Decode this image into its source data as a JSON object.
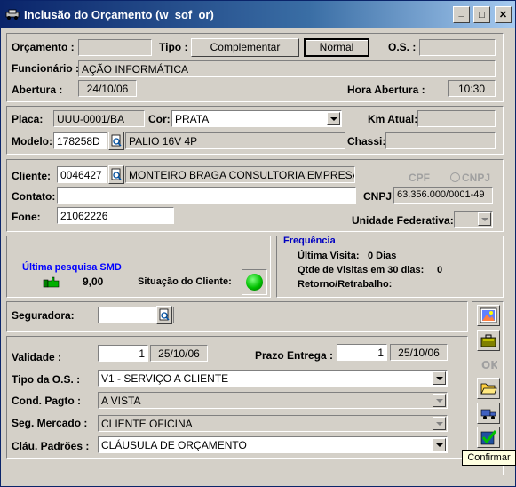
{
  "window": {
    "title": "Inclusão do Orçamento (w_sof_or)"
  },
  "titlebar_buttons": {
    "minimize": "_",
    "maximize": "□",
    "close": "✕"
  },
  "header": {
    "orcamento_label": "Orçamento :",
    "orcamento_value": "",
    "tipo_label": "Tipo :",
    "tipo_complementar": "Complementar",
    "tipo_normal": "Normal",
    "os_label": "O.S. :",
    "os_value": "",
    "funcionario_label": "Funcionário :",
    "funcionario_value": "AÇÃO INFORMÁTICA",
    "abertura_label": "Abertura :",
    "abertura_value": "24/10/06",
    "hora_abertura_label": "Hora Abertura :",
    "hora_abertura_value": "10:30"
  },
  "vehicle": {
    "placa_label": "Placa:",
    "placa_value": "UUU-0001/BA",
    "cor_label": "Cor:",
    "cor_value": "PRATA",
    "km_label": "Km Atual:",
    "km_value": "",
    "modelo_label": "Modelo:",
    "modelo_code": "178258D",
    "modelo_desc": "PALIO 16V 4P",
    "chassi_label": "Chassi:",
    "chassi_value": ""
  },
  "client": {
    "cliente_label": "Cliente:",
    "cliente_code": "0046427",
    "cliente_name": "MONTEIRO BRAGA CONSULTORIA EMPRESAI",
    "cpf_label": "CPF",
    "cnpj_radio_label": "CNPJ",
    "contato_label": "Contato:",
    "contato_value": "",
    "cnpj_label": "CNPJ:",
    "cnpj_value": "63.356.000/0001-49",
    "fone_label": "Fone:",
    "fone_value": "21062226",
    "uf_label": "Unidade Federativa:",
    "uf_value": ""
  },
  "status": {
    "smd_label": "Última pesquisa SMD",
    "smd_value": "9,00",
    "situacao_label": "Situação do Cliente:",
    "situacao_color": "#00c000",
    "frequencia_title": "Frequência",
    "ultima_visita_label": "Última Visita:",
    "ultima_visita_value": "0 Dias",
    "qtde_label": "Qtde de Visitas em 30 dias:",
    "qtde_value": "0",
    "retorno_label": "Retorno/Retrabalho:"
  },
  "seguradora": {
    "label": "Seguradora:",
    "code": "",
    "name": ""
  },
  "terms": {
    "validade_label": "Validade :",
    "validade_days": "1",
    "validade_date": "25/10/06",
    "prazo_label": "Prazo Entrega :",
    "prazo_days": "1",
    "prazo_date": "25/10/06",
    "tipo_os_label": "Tipo da O.S. :",
    "tipo_os_value": "V1 - SERVIÇO A CLIENTE",
    "cond_pagto_label": "Cond. Pagto :",
    "cond_pagto_value": "A VISTA",
    "seg_mercado_label": "Seg. Mercado :",
    "seg_mercado_value": "CLIENTE OFICINA",
    "clau_label": "Cláu. Padrões :",
    "clau_value": "CLÁUSULA DE ORÇAMENTO"
  },
  "toolbar": {
    "tooltip": "Confirmar"
  },
  "colors": {
    "accent_blue": "#0000c0",
    "smd_blue": "#0000ff"
  }
}
